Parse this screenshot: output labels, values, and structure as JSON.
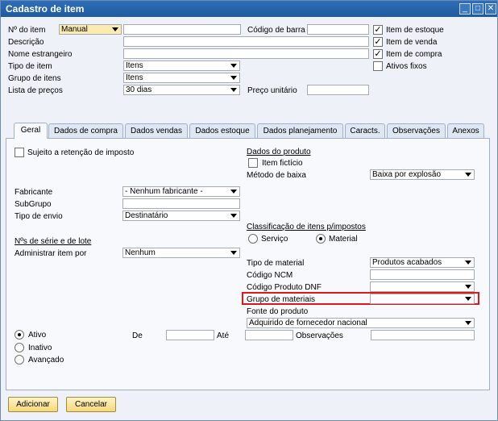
{
  "window": {
    "title": "Cadastro de item",
    "controls": [
      "_",
      "□",
      "✕"
    ]
  },
  "header": {
    "item_no_label": "Nº do item",
    "item_no_mode": "Manual",
    "item_no_value": "",
    "description_label": "Descrição",
    "foreign_name_label": "Nome estrangeiro",
    "item_type_label": "Tipo de item",
    "item_type_value": "Itens",
    "item_group_label": "Grupo de itens",
    "item_group_value": "Itens",
    "price_list_label": "Lista de preços",
    "price_list_value": "30 dias",
    "barcode_label": "Código de barra",
    "unit_price_label": "Preço unitário",
    "checkboxes": [
      {
        "label": "Item de estoque",
        "checked": true
      },
      {
        "label": "Item de venda",
        "checked": true
      },
      {
        "label": "Item de compra",
        "checked": true
      },
      {
        "label": "Ativos fixos",
        "checked": false
      }
    ]
  },
  "tabs": [
    "Geral",
    "Dados de compra",
    "Dados vendas",
    "Dados estoque",
    "Dados planejamento",
    "Caracts.",
    "Observações",
    "Anexos"
  ],
  "general": {
    "withholding_label": "Sujeito a retenção de imposto",
    "manufacturer_label": "Fabricante",
    "manufacturer_value": "- Nenhum fabricante -",
    "subgroup_label": "SubGrupo",
    "shipping_label": "Tipo de envio",
    "shipping_value": "Destinatário",
    "serial_section": "Nºs de série e de lote",
    "manage_by_label": "Administrar item por",
    "manage_by_value": "Nenhum",
    "product_data_title": "Dados do produto",
    "fictitious_label": "Item fictício",
    "issue_method_label": "Método de baixa",
    "issue_method_value": "Baixa por explosão",
    "classification_title": "Classificação de itens p/impostos",
    "service_label": "Serviço",
    "material_label": "Material",
    "material_type_label": "Tipo de material",
    "material_type_value": "Produtos acabados",
    "ncm_label": "Código NCM",
    "dnf_label": "Código Produto DNF",
    "material_group_label": "Grupo de materiais",
    "product_source_label": "Fonte do produto",
    "product_source_value": "Adquirido de fornecedor nacional",
    "status": {
      "active": "Ativo",
      "inactive": "Inativo",
      "advanced": "Avançado"
    },
    "from_label": "De",
    "to_label": "Até",
    "remarks_label": "Observações"
  },
  "buttons": {
    "add": "Adicionar",
    "cancel": "Cancelar"
  }
}
